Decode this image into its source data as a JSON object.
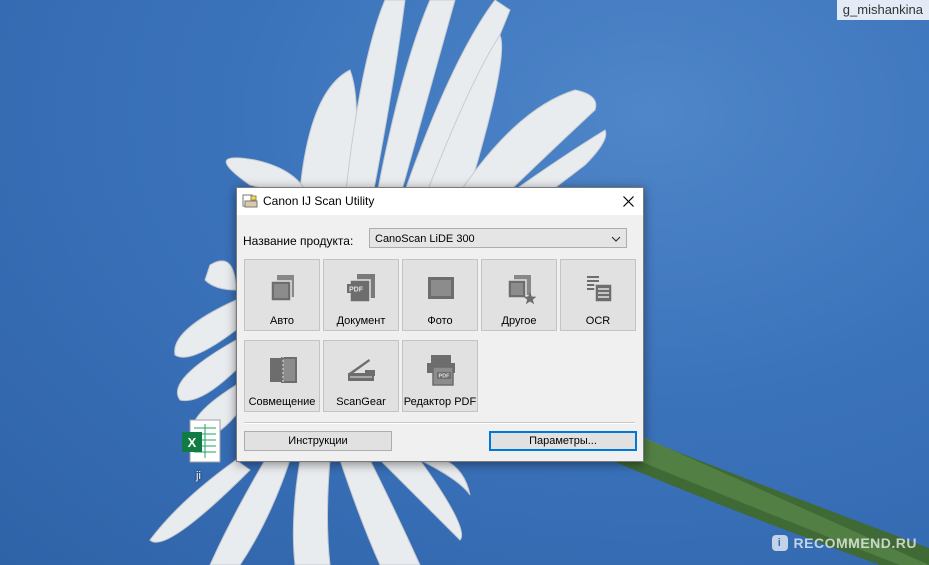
{
  "watermarks": {
    "username": "g_mishankina",
    "brand": "RECOMMEND.RU",
    "brand_mark": "i"
  },
  "desktop": {
    "file_label": "ji"
  },
  "window": {
    "title": "Canon IJ Scan Utility",
    "product_label": "Название продукта:",
    "product_value": "CanoScan LiDE 300",
    "tiles": [
      {
        "label": "Авто",
        "icon": "auto-scan-icon"
      },
      {
        "label": "Документ",
        "icon": "document-pdf-icon"
      },
      {
        "label": "Фото",
        "icon": "photo-icon"
      },
      {
        "label": "Другое",
        "icon": "custom-scan-icon"
      },
      {
        "label": "OCR",
        "icon": "ocr-icon"
      },
      {
        "label": "Совмещение",
        "icon": "stitch-icon"
      },
      {
        "label": "ScanGear",
        "icon": "scangear-icon"
      },
      {
        "label": "Редактор PDF",
        "icon": "pdf-editor-icon"
      }
    ],
    "buttons": {
      "instructions": "Инструкции",
      "settings": "Параметры..."
    },
    "pdf_badge": "PDF"
  },
  "colors": {
    "sky": "#3b73bb",
    "window_bg": "#f0f0f0",
    "tile_bg": "#e1e1e1",
    "accent": "#0078d7",
    "icon_gray": "#6d6d6d"
  }
}
